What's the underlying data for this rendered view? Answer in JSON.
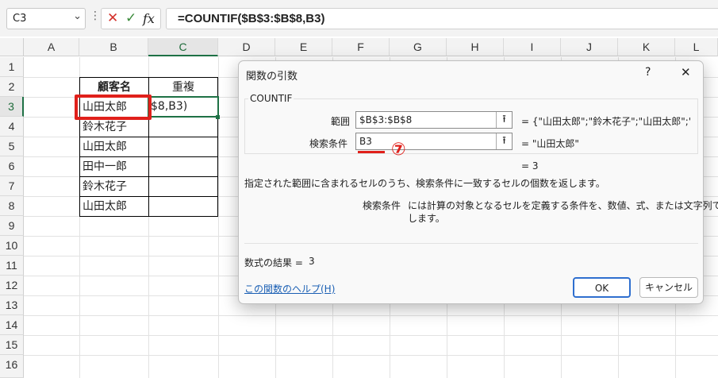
{
  "formula_bar": {
    "name_box": "C3",
    "cancel_icon": "✕",
    "enter_icon": "✓",
    "function_icon": "fx",
    "formula": "=COUNTIF($B$3:$B$8,B3)"
  },
  "columns": [
    "A",
    "B",
    "C",
    "D",
    "E",
    "F",
    "G",
    "H",
    "I",
    "J",
    "K",
    "L"
  ],
  "rows": [
    "1",
    "2",
    "3",
    "4",
    "5",
    "6",
    "7",
    "8",
    "9",
    "10",
    "11",
    "12",
    "13",
    "14",
    "15",
    "16"
  ],
  "table": {
    "header_name": "顧客名",
    "header_dup": "重複",
    "names": [
      "山田太郎",
      "鈴木花子",
      "山田太郎",
      "田中一郎",
      "鈴木花子",
      "山田太郎"
    ],
    "c3_edit": "$8,B3)"
  },
  "dialog": {
    "title": "関数の引数",
    "help_icon": "?",
    "close_icon": "✕",
    "function_name": "COUNTIF",
    "arg1_label": "範囲",
    "arg1_value": "$B$3:$B$8",
    "arg1_result": "= {\"山田太郎\";\"鈴木花子\";\"山田太郎\";'",
    "arg2_label": "検索条件",
    "arg2_value": "B3",
    "arg2_result": "= \"山田太郎\"",
    "collapse_icon": "⭱",
    "overall_result": "= 3",
    "description": "指定された範囲に含まれるセルのうち、検索条件に一致するセルの個数を返します。",
    "param_name": "検索条件",
    "param_desc_line1": "には計算の対象となるセルを定義する条件を、数値、式、または文字列で指定",
    "param_desc_line2": "します。",
    "formula_result_label": "数式の結果 =",
    "formula_result_value": "3",
    "help_link": "この関数のヘルプ(H)",
    "ok_label": "OK",
    "cancel_label": "キャンセル"
  },
  "annotation": {
    "step_label": "⑦",
    "accent_color": "#e0201b"
  }
}
